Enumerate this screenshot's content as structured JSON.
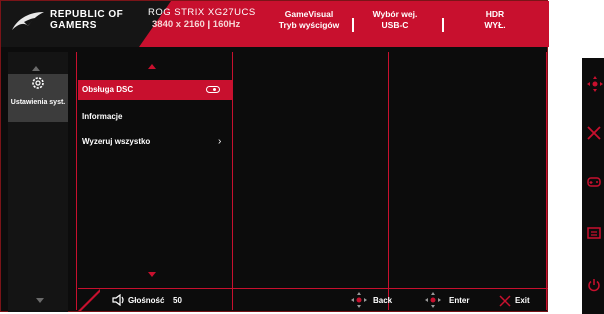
{
  "header": {
    "brand_line1": "REPUBLIC OF",
    "brand_line2": "GAMERS",
    "model": "ROG STRIX XG27UCS",
    "resolution": "3840 x 2160",
    "refresh": "160Hz",
    "status": [
      {
        "line1": "GameVisual",
        "line2": "Tryb wyścigów"
      },
      {
        "line1": "Wybór wej.",
        "line2": "USB-C"
      },
      {
        "line1": "HDR",
        "line2": "WYŁ."
      }
    ]
  },
  "sidebar": {
    "selected_label": "Ustawienia syst.",
    "selected_icon": "gear-icon"
  },
  "menu": {
    "items": [
      {
        "label": "Obsługa DSC",
        "control": "toggle"
      },
      {
        "label": "Informacje",
        "control": ""
      },
      {
        "label": "Wyzeruj wszystko",
        "control": "chevron"
      }
    ],
    "selected_index": 0
  },
  "bottom_bar": {
    "volume_icon": "speaker-icon",
    "volume_label": "Głośność",
    "volume_value": "50",
    "actions": [
      {
        "icon": "joystick-icon",
        "label": "Back"
      },
      {
        "icon": "joystick-icon",
        "label": "Enter"
      },
      {
        "icon": "close-icon",
        "label": "Exit"
      }
    ]
  },
  "hardware_keys": [
    "joystick-icon",
    "close-icon",
    "gamepad-icon",
    "gameplus-icon",
    "power-icon"
  ],
  "colors": {
    "accent": "#c8102e",
    "panel": "#0c0c0c",
    "selected_sidebar": "#3c3c3c"
  }
}
